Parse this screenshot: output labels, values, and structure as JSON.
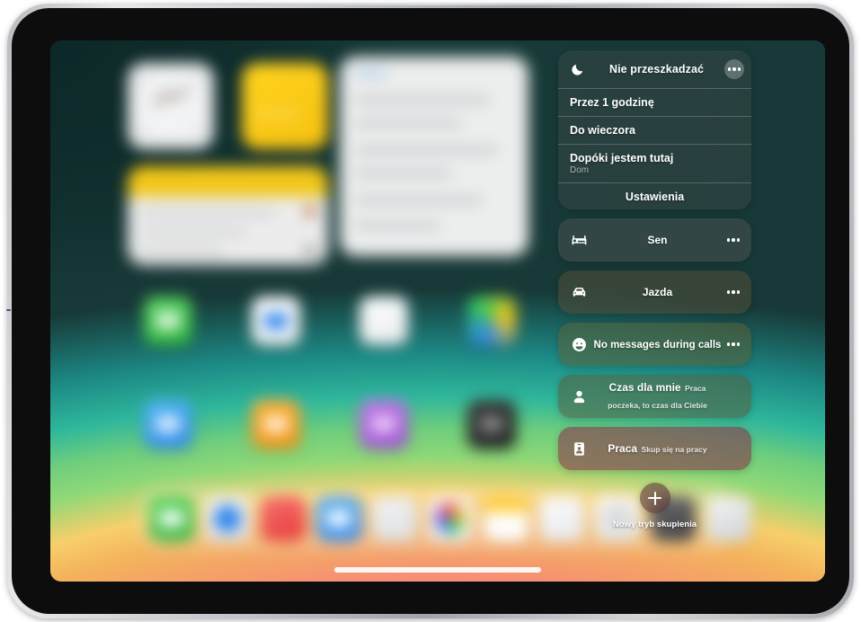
{
  "device": {
    "type": "ipad"
  },
  "focus_panel": {
    "dnd": {
      "icon": "moon-icon",
      "title": "Nie przeszkadzać",
      "more_icon": "ellipsis-icon",
      "options": [
        {
          "label": "Przez 1 godzinę",
          "sublabel": ""
        },
        {
          "label": "Do wieczora",
          "sublabel": ""
        },
        {
          "label": "Dopóki jestem tutaj",
          "sublabel": "Dom"
        }
      ],
      "settings_label": "Ustawienia"
    },
    "modes": [
      {
        "icon": "bed-icon",
        "title": "Sen",
        "subtitle": "",
        "tint": "tint-sen"
      },
      {
        "icon": "car-icon",
        "title": "Jazda",
        "subtitle": "",
        "tint": "tint-jazda"
      },
      {
        "icon": "smiley-icon",
        "title": "No messages during calls",
        "subtitle": "",
        "tint": "tint-msg"
      },
      {
        "icon": "person-icon",
        "title": "Czas dla mnie",
        "subtitle": "Praca poczeka, to czas dla Ciebie",
        "tint": "tint-czas"
      },
      {
        "icon": "badge-icon",
        "title": "Praca",
        "subtitle": "Skup się na pracy",
        "tint": "tint-praca"
      }
    ],
    "new_focus": {
      "icon": "plus-icon",
      "label": "Nowy tryb skupienia"
    }
  },
  "colors": {
    "wallpaper_teal": "#2aa58f",
    "wallpaper_green": "#8fd877",
    "wallpaper_orange": "#f4b35c",
    "wallpaper_pink": "#f5277f",
    "panel_text": "#ffffff"
  }
}
